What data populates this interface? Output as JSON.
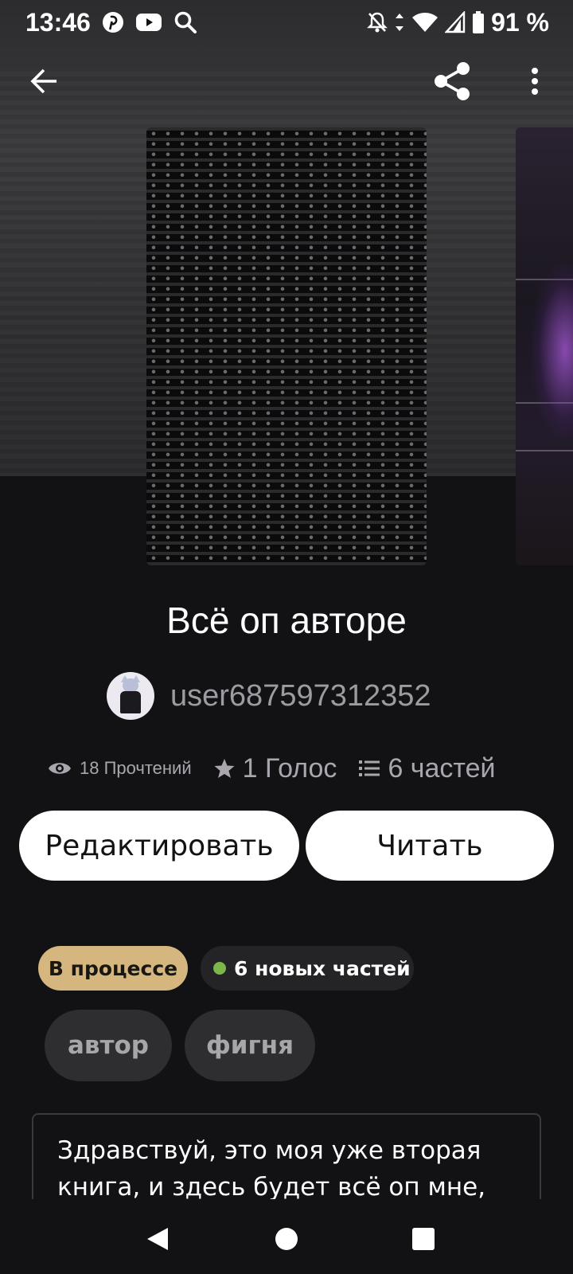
{
  "status_bar": {
    "time": "13:46",
    "battery": "91 %"
  },
  "app_bar": {
    "back_icon": "arrow-left-icon",
    "share_icon": "share-icon",
    "more_icon": "more-vertical-icon"
  },
  "story": {
    "title": "Всё оп авторе",
    "author": "user687597312352",
    "reads": "18 Прочтений",
    "votes": "1 Голос",
    "parts": "6 частей"
  },
  "actions": {
    "edit_label": "Редактировать",
    "read_label": "Читать"
  },
  "badges": {
    "status": "В процессе",
    "new_parts": "6 новых частей",
    "new_dot_color": "#7bb64a",
    "status_color": "#d4b67e"
  },
  "tags": [
    "автор",
    "фигня"
  ],
  "description": "Здравствуй, это моя уже вторая книга, и здесь будет всё оп мне, ну и",
  "nav": {
    "back_icon": "nav-back-triangle-icon",
    "home_icon": "nav-home-circle-icon",
    "recents_icon": "nav-recents-square-icon"
  }
}
